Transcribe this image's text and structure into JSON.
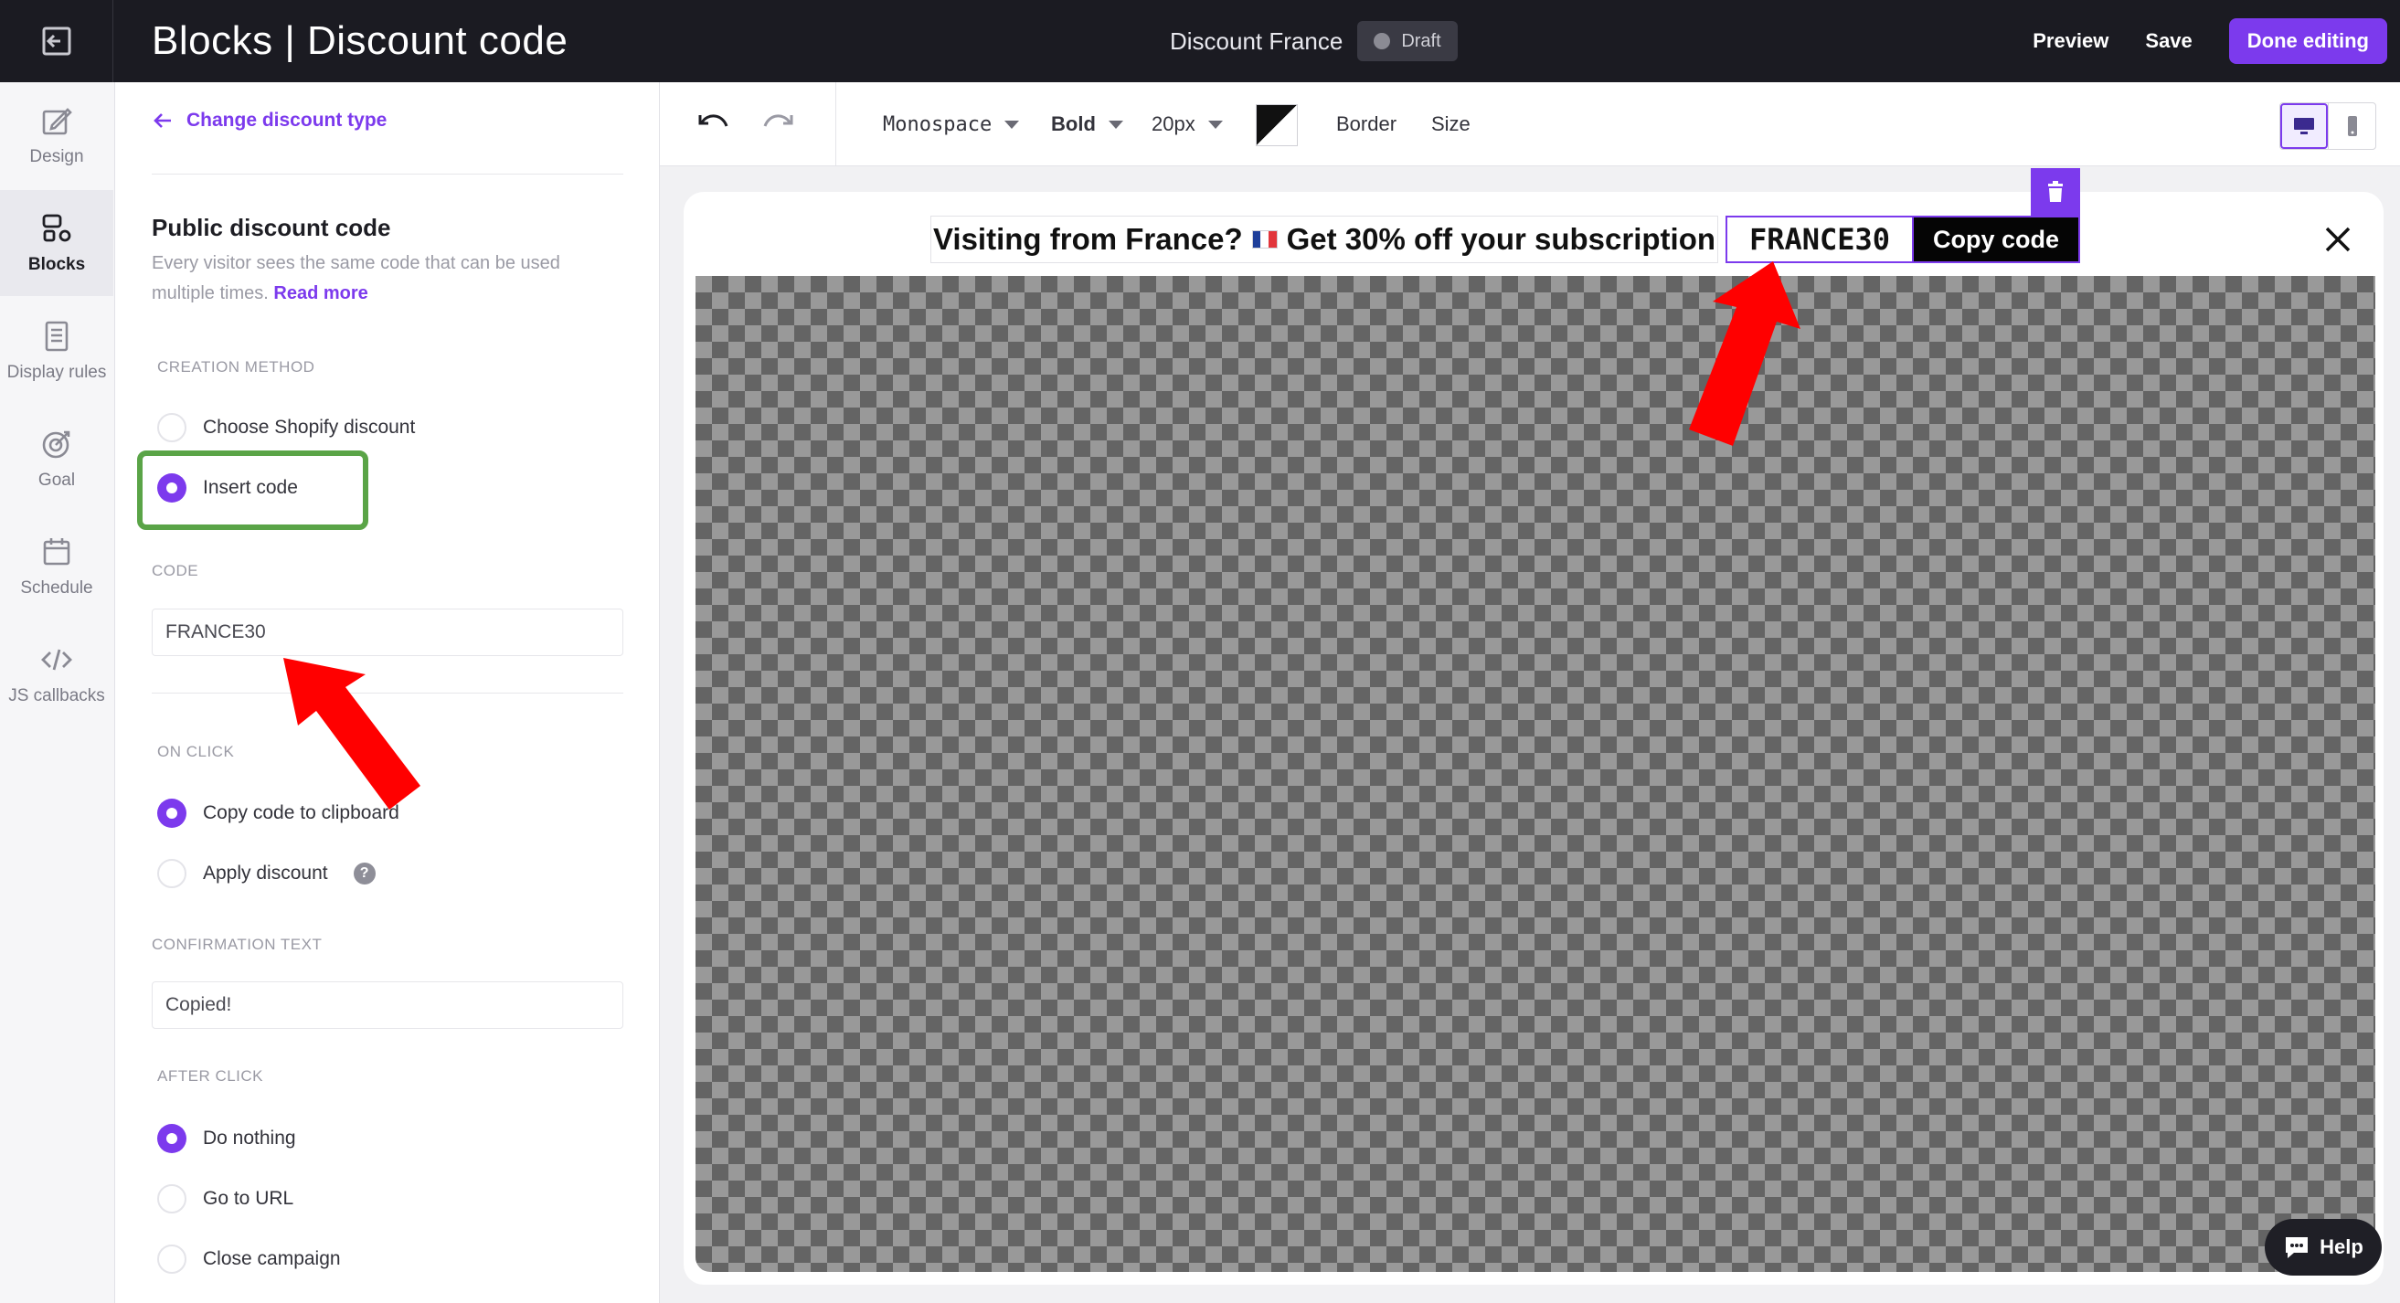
{
  "topbar": {
    "title": "Blocks | Discount code",
    "campaign_name": "Discount France",
    "status": "Draft",
    "preview_label": "Preview",
    "save_label": "Save",
    "done_label": "Done editing"
  },
  "rail": {
    "items": [
      {
        "label": "Design",
        "icon": "design-icon"
      },
      {
        "label": "Blocks",
        "icon": "blocks-icon",
        "active": true
      },
      {
        "label": "Display rules",
        "icon": "display-rules-icon"
      },
      {
        "label": "Goal",
        "icon": "goal-icon"
      },
      {
        "label": "Schedule",
        "icon": "calendar-icon"
      },
      {
        "label": "JS callbacks",
        "icon": "code-icon"
      }
    ]
  },
  "panel": {
    "back_label": "Change discount type",
    "heading": "Public discount code",
    "description": "Every visitor sees the same code that can be used multiple times.",
    "read_more": "Read more",
    "creation_method": {
      "label": "CREATION METHOD",
      "options": [
        "Choose Shopify discount",
        "Insert code"
      ],
      "selected": "Insert code"
    },
    "code": {
      "label": "CODE",
      "value": "FRANCE30"
    },
    "on_click": {
      "label": "ON CLICK",
      "options": [
        "Copy code to clipboard",
        "Apply discount"
      ],
      "selected": "Copy code to clipboard"
    },
    "confirmation": {
      "label": "CONFIRMATION TEXT",
      "value": "Copied!"
    },
    "after_click": {
      "label": "AFTER CLICK",
      "options": [
        "Do nothing",
        "Go to URL",
        "Close campaign"
      ],
      "selected": "Do nothing"
    }
  },
  "toolbar": {
    "font": "Monospace",
    "weight": "Bold",
    "size": "20px",
    "border_label": "Border",
    "size_label": "Size",
    "text_color": "#111111"
  },
  "preview": {
    "message_part1": "Visiting from France?",
    "message_part2": "Get 30% off your subscription",
    "code": "FRANCE30",
    "copy_button": "Copy code"
  },
  "help_label": "Help",
  "colors": {
    "accent": "#7c3aed",
    "annotation_arrow": "#ff0000",
    "annotation_box": "#5aa447",
    "topbar_bg": "#1b1b22"
  }
}
